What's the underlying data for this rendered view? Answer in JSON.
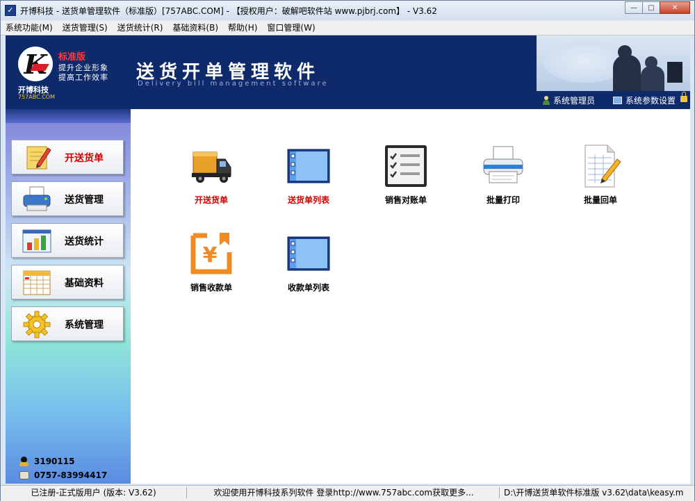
{
  "window": {
    "title": "开博科技 - 送货单管理软件（标准版）[757ABC.COM] - 【授权用户：破解吧软件站 www.pjbrj.com】 - V3.62",
    "minimize_glyph": "—",
    "maximize_glyph": "□",
    "close_glyph": "✕"
  },
  "menu": [
    {
      "label": "系统功能(M)"
    },
    {
      "label": "送货管理(S)"
    },
    {
      "label": "送货统计(R)"
    },
    {
      "label": "基础资料(B)"
    },
    {
      "label": "帮助(H)"
    },
    {
      "label": "窗口管理(W)"
    }
  ],
  "banner": {
    "edition": "标准版",
    "slogan_line1": "提升企业形象",
    "slogan_line2": "提高工作效率",
    "company": "开博科技",
    "company_url": "757ABC.COM",
    "app_title": "送货开单管理软件",
    "app_subtitle": "Delivery bill management software",
    "user_link": "系统管理员",
    "settings_link": "系统参数设置",
    "logo_letter": "K"
  },
  "sidebar": {
    "items": [
      {
        "label": "开送货单",
        "icon": "pencil-note-icon"
      },
      {
        "label": "送货管理",
        "icon": "printer-icon"
      },
      {
        "label": "送货统计",
        "icon": "bar-chart-icon"
      },
      {
        "label": "基础资料",
        "icon": "spreadsheet-icon"
      },
      {
        "label": "系统管理",
        "icon": "gear-icon"
      }
    ],
    "qq": "3190115",
    "phone": "0757-83994417"
  },
  "main": {
    "tiles": [
      {
        "label": "开送货单",
        "icon": "truck-icon"
      },
      {
        "label": "送货单列表",
        "icon": "list-window-icon"
      },
      {
        "label": "销售对账单",
        "icon": "checklist-icon"
      },
      {
        "label": "批量打印",
        "icon": "printer-icon"
      },
      {
        "label": "批量回单",
        "icon": "document-edit-icon"
      },
      {
        "label": "销售收款单",
        "icon": "yuan-receipt-icon"
      },
      {
        "label": "收款单列表",
        "icon": "list-window-icon"
      }
    ]
  },
  "status": {
    "registration": "已注册-正式版用户 (版本: V3.62)",
    "message": "欢迎使用开博科技系列软件   登录http://www.757abc.com获取更多...",
    "path": "D:\\开博送货单软件标准版 v3.62\\data\\keasy.m"
  },
  "colors": {
    "banner_bg": "#0f2a6b",
    "active_label": "#d40000",
    "edition_red": "#ff3a3a"
  }
}
